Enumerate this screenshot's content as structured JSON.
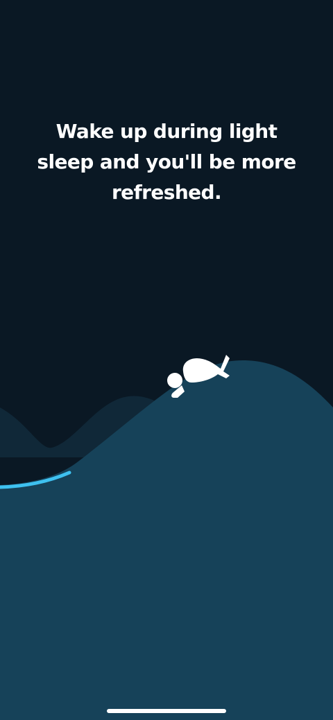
{
  "onboarding": {
    "headline_lines": [
      "Wake up during light",
      "sleep and you'll be more",
      "refreshed."
    ],
    "illustration": {
      "icon": "sleeping-person-icon",
      "description_colors": {
        "background": "#0a1824",
        "back_wave": "#102838",
        "front_wave": "#164259",
        "progress_arc": "#3ec1f0",
        "figure": "#ffffff"
      }
    }
  },
  "system": {
    "home_indicator": "home-indicator"
  }
}
